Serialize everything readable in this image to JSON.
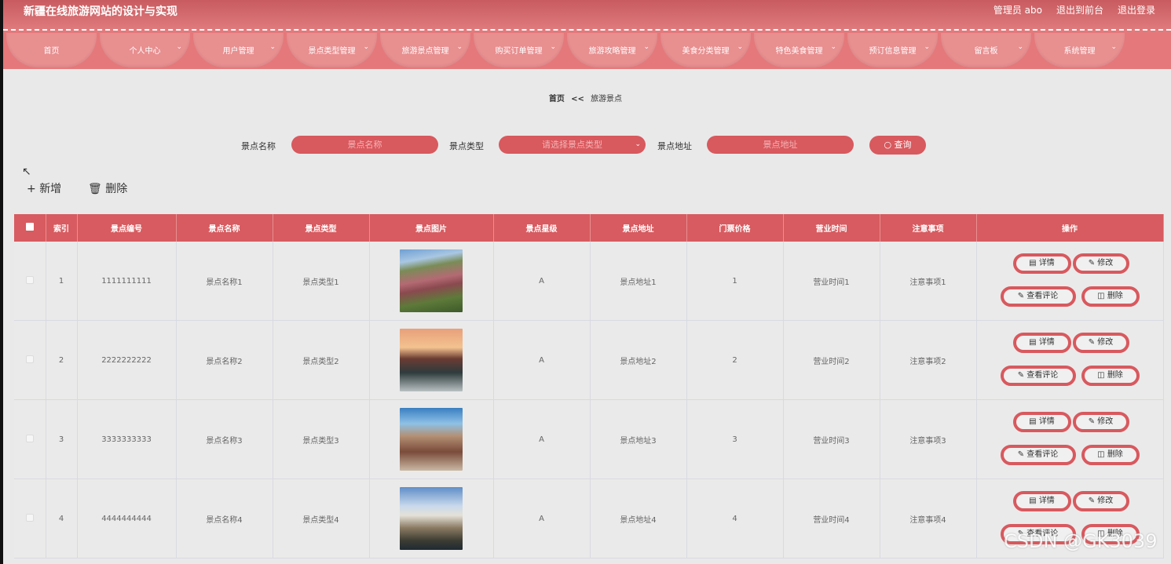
{
  "site_title": "新疆在线旅游网站的设计与实现",
  "top_links": [
    "管理员 abo",
    "退出到前台",
    "退出登录"
  ],
  "nav": [
    {
      "label": "首页",
      "chevron": false
    },
    {
      "label": "个人中心",
      "chevron": true
    },
    {
      "label": "用户管理",
      "chevron": true
    },
    {
      "label": "景点类型管理",
      "chevron": true
    },
    {
      "label": "旅游景点管理",
      "chevron": true
    },
    {
      "label": "购买订单管理",
      "chevron": true
    },
    {
      "label": "旅游攻略管理",
      "chevron": true
    },
    {
      "label": "美食分类管理",
      "chevron": true
    },
    {
      "label": "特色美食管理",
      "chevron": true
    },
    {
      "label": "预订信息管理",
      "chevron": true
    },
    {
      "label": "留言板",
      "chevron": true
    },
    {
      "label": "系统管理",
      "chevron": true
    }
  ],
  "breadcrumb": {
    "home": "首页",
    "sep": "<<",
    "current": "旅游景点"
  },
  "search": {
    "name_label": "景点名称",
    "name_placeholder": "景点名称",
    "type_label": "景点类型",
    "type_placeholder": "请选择景点类型",
    "addr_label": "景点地址",
    "addr_placeholder": "景点地址",
    "query_button": "查询"
  },
  "actions": {
    "add": "新增",
    "delete": "删除"
  },
  "table": {
    "headers": [
      "索引",
      "景点编号",
      "景点名称",
      "景点类型",
      "景点图片",
      "景点星级",
      "景点地址",
      "门票价格",
      "营业时间",
      "注意事项",
      "操作"
    ],
    "rows": [
      {
        "index": "1",
        "code": "1111111111",
        "name": "景点名称1",
        "type": "景点类型1",
        "star": "A",
        "addr": "景点地址1",
        "price": "1",
        "hours": "营业时间1",
        "notes": "注意事项1"
      },
      {
        "index": "2",
        "code": "2222222222",
        "name": "景点名称2",
        "type": "景点类型2",
        "star": "A",
        "addr": "景点地址2",
        "price": "2",
        "hours": "营业时间2",
        "notes": "注意事项2"
      },
      {
        "index": "3",
        "code": "3333333333",
        "name": "景点名称3",
        "type": "景点类型3",
        "star": "A",
        "addr": "景点地址3",
        "price": "3",
        "hours": "营业时间3",
        "notes": "注意事项3"
      },
      {
        "index": "4",
        "code": "4444444444",
        "name": "景点名称4",
        "type": "景点类型4",
        "star": "A",
        "addr": "景点地址4",
        "price": "4",
        "hours": "营业时间4",
        "notes": "注意事项4"
      }
    ],
    "row_buttons": {
      "detail": "详情",
      "edit": "修改",
      "comments": "查看评论",
      "delete": "删除"
    }
  },
  "watermark": "CSDN @GK3039",
  "colors": {
    "accent": "#d8595e",
    "header_bg": "#e07c7f",
    "nav_item": "#e88f90",
    "page_bg": "#e9e9e9"
  }
}
